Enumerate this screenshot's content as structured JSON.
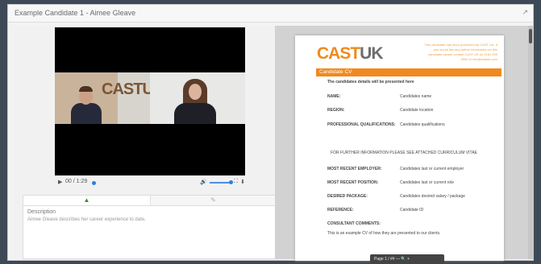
{
  "window": {
    "title": "Example Candidate 1 - Aimee Gleave",
    "expand_icon": "↗"
  },
  "video": {
    "wall_logo": "CASTUK",
    "time": "00 / 1:29",
    "play_icon": "▶",
    "volume_icon": "🔊",
    "fullscreen_icon": "⛶",
    "download_icon": "⬇",
    "volume_level": 0.9
  },
  "tabs": [
    {
      "icon": "▲"
    },
    {
      "icon": "✎"
    }
  ],
  "description": {
    "label": "Description",
    "text": "Aimee Gleave describes her career experience to date."
  },
  "cv": {
    "logo_cast": "CAST",
    "logo_uk": "UK",
    "address": "This candidate has been presented by CAST UK. If you would like any further information on this candidate please contact CAST UK on 0161 000 0000 or info@castuk.com",
    "bar_title": "Candidate CV",
    "intro": "The candidates details will be presented here",
    "fields": [
      {
        "label": "NAME:",
        "value": "Candidates name"
      },
      {
        "label": "REGION:",
        "value": "Candidate location"
      },
      {
        "label": "PROFESSIONAL QUALIFICATIONS:",
        "value": "Candidates qualifications"
      },
      {
        "label": "MOST RECENT EMPLOYER:",
        "value": "Candidates last or current employer"
      },
      {
        "label": "MOST RECENT POSITION:",
        "value": "Candidates last or current role"
      },
      {
        "label": "DESIRED PACKAGE:",
        "value": "Candidates desired salary / package"
      },
      {
        "label": "REFERENCE:",
        "value": "Candidate ID"
      }
    ],
    "note": "FOR FURTHER INFORMATION PLEASE SEE ATTACHED CURRICULUM VITAE",
    "comments_label": "CONSULTANT COMMENTS:",
    "comments_text": "This is an example CV of how they are presented to our clients.",
    "page_bar": "Page  1  /  ##      —  🔍  +"
  }
}
